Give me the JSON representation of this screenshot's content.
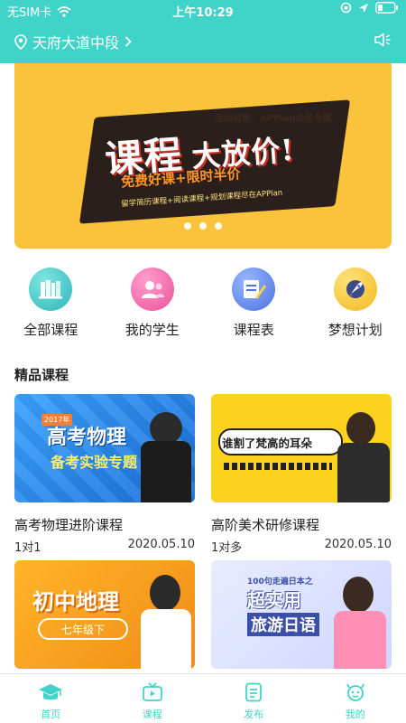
{
  "status_bar": {
    "carrier": "无SIM卡",
    "time": "上午10:29"
  },
  "location": {
    "text": "天府大道中段"
  },
  "banner": {
    "target_audience": "活动对象：APPlan会员专属",
    "title_main": "课程",
    "title_sub": "大放价!",
    "subtitle": "免费好课+限时半价",
    "tags": "留学简历课程+阅读课程+规划课程尽在APPlan",
    "page_count": 3
  },
  "quick_menu": [
    {
      "label": "全部课程",
      "icon": "books-icon",
      "color": "#37c4c1"
    },
    {
      "label": "我的学生",
      "icon": "students-icon",
      "color": "#f26cab"
    },
    {
      "label": "课程表",
      "icon": "schedule-icon",
      "color": "#5b84e6"
    },
    {
      "label": "梦想计划",
      "icon": "rocket-icon",
      "color": "#f6c52c"
    }
  ],
  "section": {
    "title": "精品课程"
  },
  "courses": [
    {
      "title": "高考物理进阶课程",
      "type": "1对1",
      "date": "2020.05.10",
      "thumb_year": "2017年",
      "thumb_line1": "高考物理",
      "thumb_line2": "备考实验专题"
    },
    {
      "title": "高阶美术研修课程",
      "type": "1对多",
      "date": "2020.05.10",
      "thumb_line1": "谁割了梵高的耳朵"
    },
    {
      "thumb_line1": "初中地理",
      "thumb_line2": "七年级下"
    },
    {
      "thumb_line0": "100句走遍日本之",
      "thumb_line1": "超实用",
      "thumb_line2": "旅游日语"
    }
  ],
  "tabbar": [
    {
      "label": "首页",
      "icon": "graduation-cap-icon"
    },
    {
      "label": "课程",
      "icon": "tv-icon"
    },
    {
      "label": "发布",
      "icon": "document-icon"
    },
    {
      "label": "我的",
      "icon": "robot-icon"
    }
  ],
  "colors": {
    "accent": "#3fd4c7",
    "banner_bg": "#fbc33b"
  }
}
